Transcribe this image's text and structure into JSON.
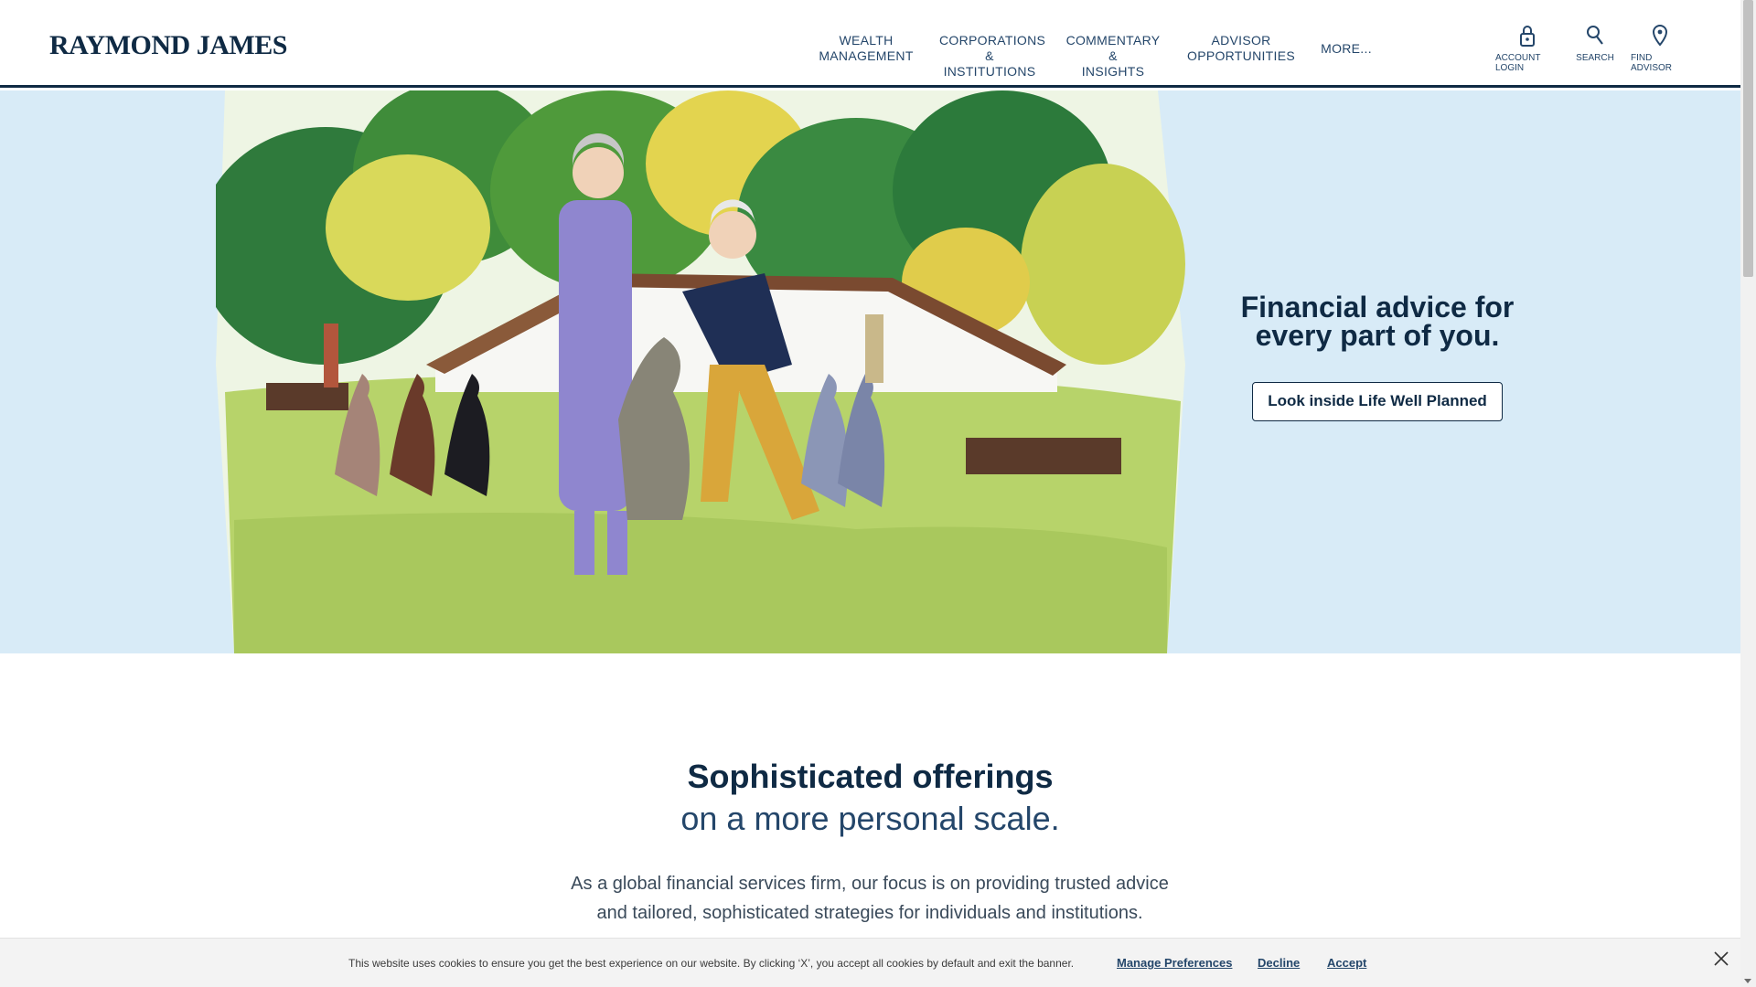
{
  "header": {
    "logo": "RAYMOND JAMES",
    "nav": [
      {
        "label": "WEALTH\nMANAGEMENT"
      },
      {
        "label": "CORPORATIONS &\nINSTITUTIONS"
      },
      {
        "label": "COMMENTARY &\nINSIGHTS"
      },
      {
        "label": "ADVISOR\nOPPORTUNITIES"
      },
      {
        "label": "MORE..."
      }
    ],
    "utils": [
      {
        "label": "ACCOUNT LOGIN",
        "icon": "lock-icon"
      },
      {
        "label": "SEARCH",
        "icon": "search-icon"
      },
      {
        "label": "FIND ADVISOR",
        "icon": "location-pin-icon"
      }
    ]
  },
  "hero": {
    "title": "Financial advice for every part of you.",
    "button_label": "Look inside Life Well Planned"
  },
  "offerings": {
    "title": "Sophisticated offerings",
    "subtitle": "on a more personal scale.",
    "body": "As a global financial services firm, our focus is on providing trusted advice and tailored, sophisticated strategies for individuals and institutions."
  },
  "cookie_banner": {
    "text": "This website uses cookies to ensure you get the best experience on our website. By clicking ‘X’, you accept all cookies by default and exit the banner.",
    "manage_label": "Manage Preferences",
    "decline_label": "Decline",
    "accept_label": "Accept",
    "close_icon": "close-icon"
  },
  "colors": {
    "brand_navy": "#0f2a44",
    "nav_text": "#24466a",
    "hero_bg": "#d8ebf7",
    "grass": "#b7d36a"
  }
}
